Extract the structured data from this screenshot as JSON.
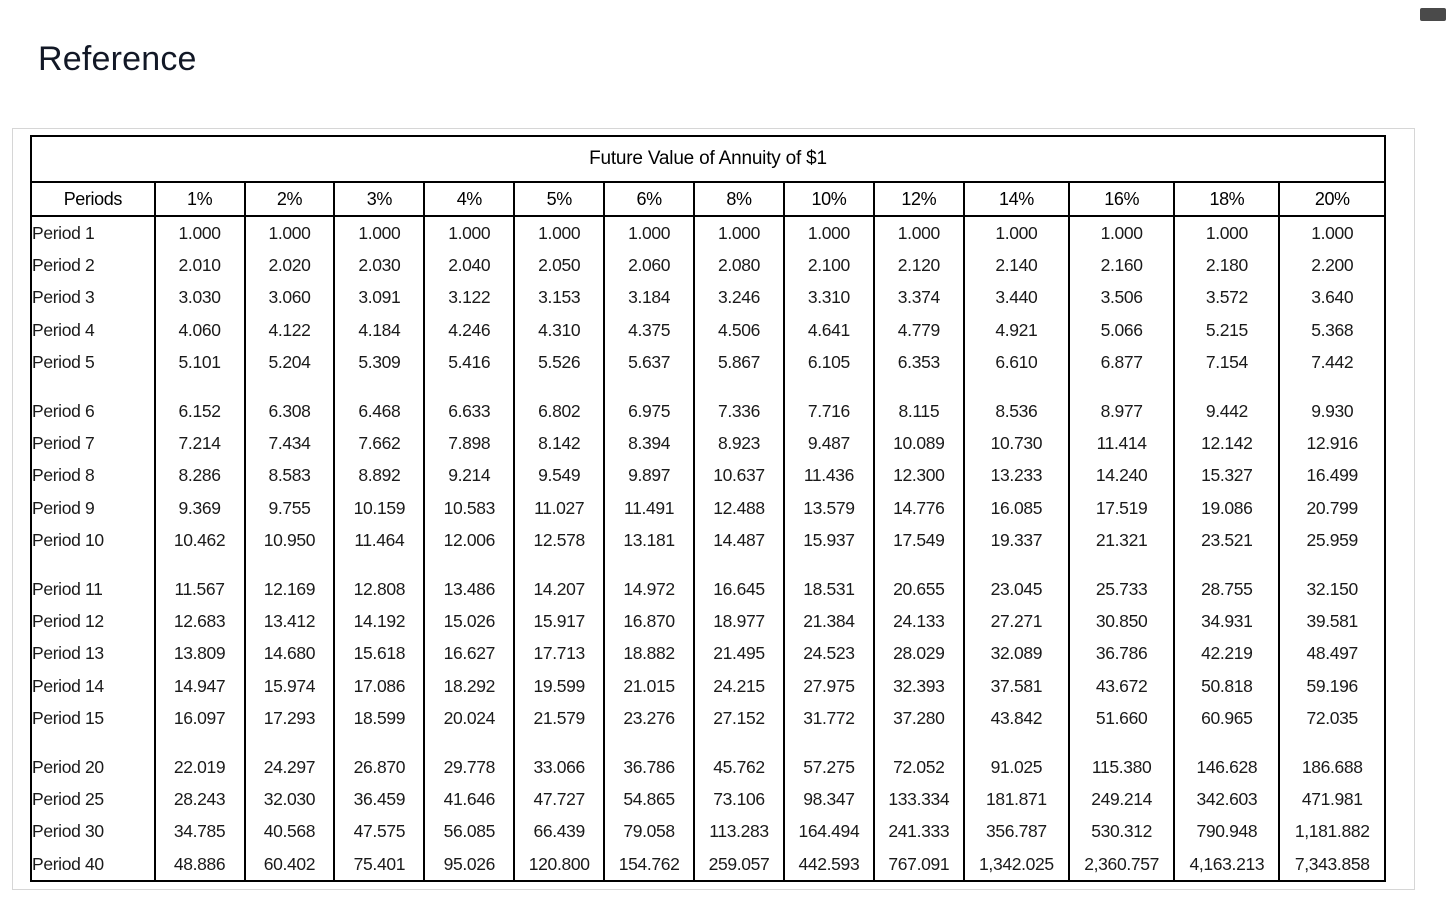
{
  "window": {
    "control_icon": "minimize-icon"
  },
  "page": {
    "title": "Reference"
  },
  "table": {
    "title": "Future Value of Annuity of $1",
    "period_header": "Periods",
    "rate_headers": [
      "1%",
      "2%",
      "3%",
      "4%",
      "5%",
      "6%",
      "8%",
      "10%",
      "12%",
      "14%",
      "16%",
      "18%",
      "20%"
    ],
    "groups": [
      {
        "rows": [
          {
            "period": "Period 1",
            "values": [
              "1.000",
              "1.000",
              "1.000",
              "1.000",
              "1.000",
              "1.000",
              "1.000",
              "1.000",
              "1.000",
              "1.000",
              "1.000",
              "1.000",
              "1.000"
            ]
          },
          {
            "period": "Period 2",
            "values": [
              "2.010",
              "2.020",
              "2.030",
              "2.040",
              "2.050",
              "2.060",
              "2.080",
              "2.100",
              "2.120",
              "2.140",
              "2.160",
              "2.180",
              "2.200"
            ]
          },
          {
            "period": "Period 3",
            "values": [
              "3.030",
              "3.060",
              "3.091",
              "3.122",
              "3.153",
              "3.184",
              "3.246",
              "3.310",
              "3.374",
              "3.440",
              "3.506",
              "3.572",
              "3.640"
            ]
          },
          {
            "period": "Period 4",
            "values": [
              "4.060",
              "4.122",
              "4.184",
              "4.246",
              "4.310",
              "4.375",
              "4.506",
              "4.641",
              "4.779",
              "4.921",
              "5.066",
              "5.215",
              "5.368"
            ]
          },
          {
            "period": "Period 5",
            "values": [
              "5.101",
              "5.204",
              "5.309",
              "5.416",
              "5.526",
              "5.637",
              "5.867",
              "6.105",
              "6.353",
              "6.610",
              "6.877",
              "7.154",
              "7.442"
            ]
          }
        ]
      },
      {
        "rows": [
          {
            "period": "Period 6",
            "values": [
              "6.152",
              "6.308",
              "6.468",
              "6.633",
              "6.802",
              "6.975",
              "7.336",
              "7.716",
              "8.115",
              "8.536",
              "8.977",
              "9.442",
              "9.930"
            ]
          },
          {
            "period": "Period 7",
            "values": [
              "7.214",
              "7.434",
              "7.662",
              "7.898",
              "8.142",
              "8.394",
              "8.923",
              "9.487",
              "10.089",
              "10.730",
              "11.414",
              "12.142",
              "12.916"
            ]
          },
          {
            "period": "Period 8",
            "values": [
              "8.286",
              "8.583",
              "8.892",
              "9.214",
              "9.549",
              "9.897",
              "10.637",
              "11.436",
              "12.300",
              "13.233",
              "14.240",
              "15.327",
              "16.499"
            ]
          },
          {
            "period": "Period 9",
            "values": [
              "9.369",
              "9.755",
              "10.159",
              "10.583",
              "11.027",
              "11.491",
              "12.488",
              "13.579",
              "14.776",
              "16.085",
              "17.519",
              "19.086",
              "20.799"
            ]
          },
          {
            "period": "Period 10",
            "values": [
              "10.462",
              "10.950",
              "11.464",
              "12.006",
              "12.578",
              "13.181",
              "14.487",
              "15.937",
              "17.549",
              "19.337",
              "21.321",
              "23.521",
              "25.959"
            ]
          }
        ]
      },
      {
        "rows": [
          {
            "period": "Period 11",
            "values": [
              "11.567",
              "12.169",
              "12.808",
              "13.486",
              "14.207",
              "14.972",
              "16.645",
              "18.531",
              "20.655",
              "23.045",
              "25.733",
              "28.755",
              "32.150"
            ]
          },
          {
            "period": "Period 12",
            "values": [
              "12.683",
              "13.412",
              "14.192",
              "15.026",
              "15.917",
              "16.870",
              "18.977",
              "21.384",
              "24.133",
              "27.271",
              "30.850",
              "34.931",
              "39.581"
            ]
          },
          {
            "period": "Period 13",
            "values": [
              "13.809",
              "14.680",
              "15.618",
              "16.627",
              "17.713",
              "18.882",
              "21.495",
              "24.523",
              "28.029",
              "32.089",
              "36.786",
              "42.219",
              "48.497"
            ]
          },
          {
            "period": "Period 14",
            "values": [
              "14.947",
              "15.974",
              "17.086",
              "18.292",
              "19.599",
              "21.015",
              "24.215",
              "27.975",
              "32.393",
              "37.581",
              "43.672",
              "50.818",
              "59.196"
            ]
          },
          {
            "period": "Period 15",
            "values": [
              "16.097",
              "17.293",
              "18.599",
              "20.024",
              "21.579",
              "23.276",
              "27.152",
              "31.772",
              "37.280",
              "43.842",
              "51.660",
              "60.965",
              "72.035"
            ]
          }
        ]
      },
      {
        "rows": [
          {
            "period": "Period 20",
            "values": [
              "22.019",
              "24.297",
              "26.870",
              "29.778",
              "33.066",
              "36.786",
              "45.762",
              "57.275",
              "72.052",
              "91.025",
              "115.380",
              "146.628",
              "186.688"
            ]
          },
          {
            "period": "Period 25",
            "values": [
              "28.243",
              "32.030",
              "36.459",
              "41.646",
              "47.727",
              "54.865",
              "73.106",
              "98.347",
              "133.334",
              "181.871",
              "249.214",
              "342.603",
              "471.981"
            ]
          },
          {
            "period": "Period 30",
            "values": [
              "34.785",
              "40.568",
              "47.575",
              "56.085",
              "66.439",
              "79.058",
              "113.283",
              "164.494",
              "241.333",
              "356.787",
              "530.312",
              "790.948",
              "1,181.882"
            ]
          },
          {
            "period": "Period 40",
            "values": [
              "48.886",
              "60.402",
              "75.401",
              "95.026",
              "120.800",
              "154.762",
              "259.057",
              "442.593",
              "767.091",
              "1,342.025",
              "2,360.757",
              "4,163.213",
              "7,343.858"
            ]
          }
        ]
      }
    ]
  },
  "colors": {
    "heading_text": "#121826",
    "table_border": "#000000",
    "card_border": "#d6d6d6",
    "background": "#ffffff"
  }
}
